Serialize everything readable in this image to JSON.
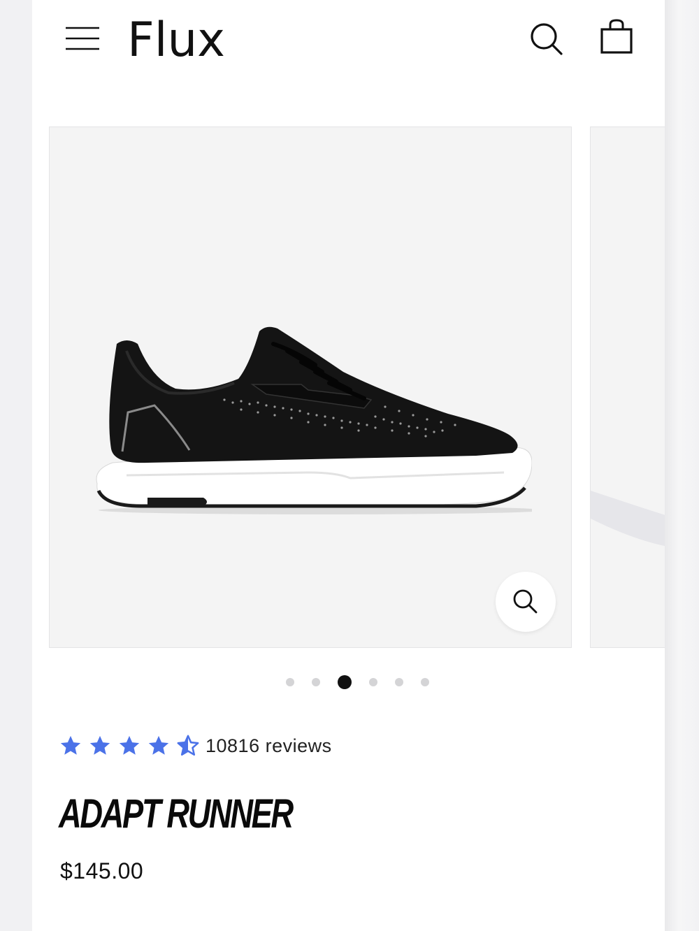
{
  "header": {
    "logo_text": "Flux",
    "menu_icon": "hamburger-menu-icon",
    "search_icon": "search-icon",
    "bag_icon": "shopping-bag-icon"
  },
  "gallery": {
    "image_alt": "black knit running sneaker with white sole",
    "zoom_icon": "zoom-icon",
    "slide_count": 6,
    "active_slide": 3
  },
  "product": {
    "rating_value": 4.5,
    "rating_max": 5,
    "star_color": "#4b72e8",
    "reviews_text": "10816 reviews",
    "name": "ADAPT RUNNER",
    "price": "$145.00"
  }
}
